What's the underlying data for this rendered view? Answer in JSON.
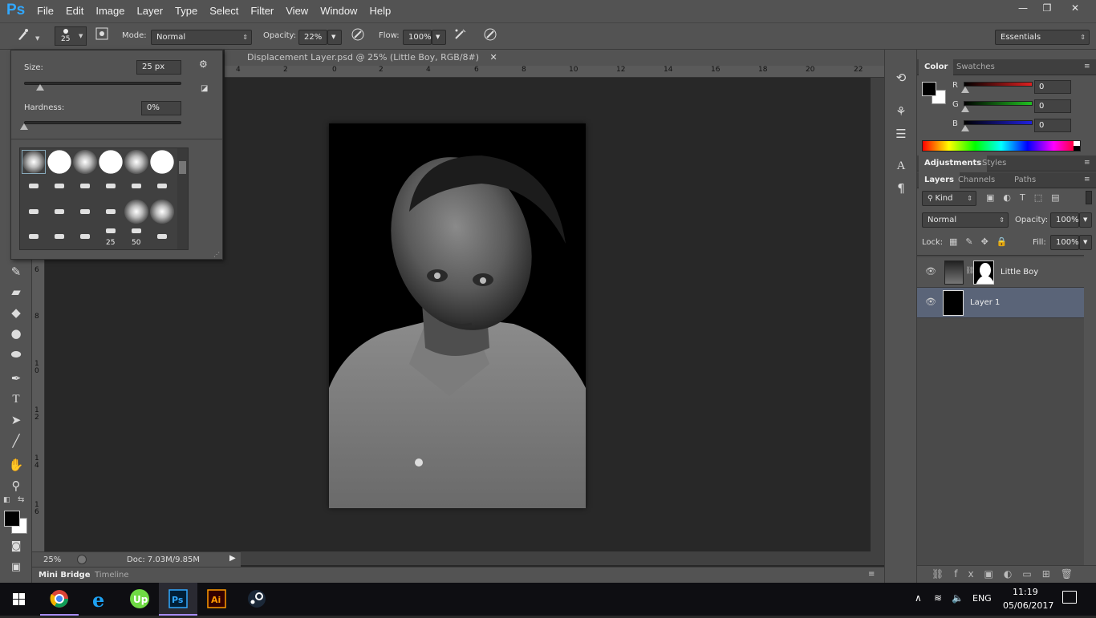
{
  "app": {
    "logo": "Ps"
  },
  "menu": [
    "File",
    "Edit",
    "Image",
    "Layer",
    "Type",
    "Select",
    "Filter",
    "View",
    "Window",
    "Help"
  ],
  "window_buttons": {
    "minimize": "—",
    "restore": "❐",
    "close": "✕"
  },
  "options_bar": {
    "brush_size": "25",
    "mode_label": "Mode:",
    "mode_value": "Normal",
    "opacity_label": "Opacity:",
    "opacity_value": "22%",
    "flow_label": "Flow:",
    "flow_value": "100%",
    "workspace": "Essentials"
  },
  "brush_popup": {
    "size_label": "Size:",
    "size_value": "25 px",
    "size_level": 0.1,
    "hardness_label": "Hardness:",
    "hardness_value": "0%",
    "hardness_level": 0.0,
    "preset_numbers": [
      "25",
      "50"
    ]
  },
  "document": {
    "tab_title": "Displacement Layer.psd @ 25% (Little Boy, RGB/8#)",
    "ruler_top": [
      "4",
      "2",
      "0",
      "2",
      "4",
      "6",
      "8",
      "10",
      "12",
      "14",
      "16",
      "18",
      "20",
      "22"
    ],
    "ruler_left": [
      "6",
      "8",
      "1\n0",
      "1\n2",
      "1\n4",
      "1\n6"
    ]
  },
  "status": {
    "zoom": "25%",
    "doc": "Doc: 7.03M/9.85M"
  },
  "bottom_tabs": [
    "Mini Bridge",
    "Timeline"
  ],
  "color_panel": {
    "tabs": [
      "Color",
      "Swatches"
    ],
    "channels": [
      {
        "label": "R",
        "value": "0",
        "color": "#e02020"
      },
      {
        "label": "G",
        "value": "0",
        "color": "#20c020"
      },
      {
        "label": "B",
        "value": "0",
        "color": "#2020e0"
      }
    ]
  },
  "adjust_panel": {
    "tabs": [
      "Adjustments",
      "Styles"
    ]
  },
  "layers_panel": {
    "tabs": [
      "Layers",
      "Channels",
      "Paths"
    ],
    "filter": "Kind",
    "blend_mode": "Normal",
    "opacity_label": "Opacity:",
    "opacity_value": "100%",
    "lock_label": "Lock:",
    "fill_label": "Fill:",
    "fill_value": "100%",
    "layers": [
      {
        "name": "Little Boy",
        "selected": false
      },
      {
        "name": "Layer 1",
        "selected": true
      }
    ]
  },
  "taskbar": {
    "language": "ENG",
    "time": "11:19",
    "date": "05/06/2017",
    "apps": [
      "windows-start",
      "chrome",
      "internet-explorer",
      "upwork",
      "photoshop",
      "illustrator",
      "steam"
    ]
  }
}
